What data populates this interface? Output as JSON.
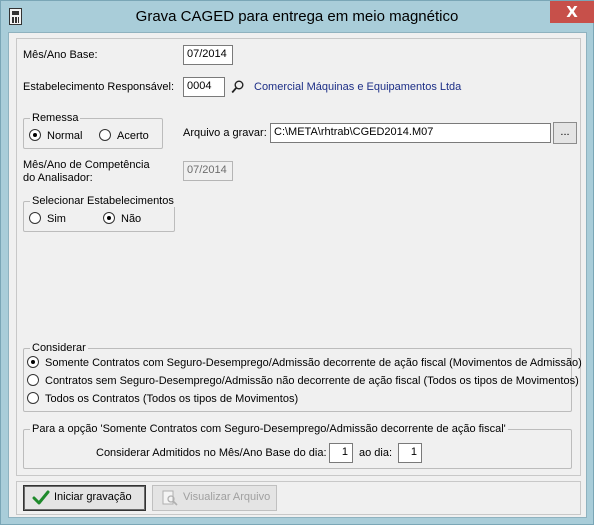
{
  "window": {
    "title": "Grava CAGED para entrega em meio magnético",
    "close_glyph": "X"
  },
  "form": {
    "mes_ano_base_label": "Mês/Ano Base:",
    "mes_ano_base_value": "07/2014",
    "estabelecimento_label": "Estabelecimento Responsável:",
    "estabelecimento_code": "0004",
    "estabelecimento_name": "Comercial Máquinas e Equipamentos Ltda",
    "remessa": {
      "legend": "Remessa",
      "options": [
        {
          "label": "Normal",
          "checked": true
        },
        {
          "label": "Acerto",
          "checked": false
        }
      ]
    },
    "arquivo_label": "Arquivo a gravar:",
    "arquivo_value": "C:\\META\\rhtrab\\CGED2014.M07",
    "browse_label": "...",
    "competencia_label_1": "Mês/Ano de Competência",
    "competencia_label_2": "do Analisador:",
    "competencia_value": "07/2014",
    "selecionar": {
      "legend": "Selecionar Estabelecimentos",
      "options": [
        {
          "label": "Sim",
          "checked": false
        },
        {
          "label": "Não",
          "checked": true
        }
      ]
    },
    "considerar": {
      "legend": "Considerar",
      "options": [
        {
          "label": "Somente Contratos com Seguro-Desemprego/Admissão decorrente de ação fiscal (Movimentos de Admissão)",
          "checked": true
        },
        {
          "label": "Contratos sem Seguro-Desemprego/Admissão não decorrente de ação fiscal (Todos os tipos de Movimentos)",
          "checked": false
        },
        {
          "label": "Todos os Contratos (Todos os tipos de Movimentos)",
          "checked": false
        }
      ]
    },
    "opcao": {
      "legend": "Para a opção 'Somente Contratos com Seguro-Desemprego/Admissão decorrente de ação fiscal'",
      "dia_label": "Considerar Admitidos no Mês/Ano Base do dia:",
      "dia_from": "1",
      "ao_dia_label": "ao dia:",
      "dia_to": "1"
    }
  },
  "buttons": {
    "iniciar": "Iniciar gravação",
    "visualizar": "Visualizar Arquivo"
  },
  "colors": {
    "frame": "#a9cdd9",
    "close": "#c7504a",
    "link": "#1c2e86"
  }
}
